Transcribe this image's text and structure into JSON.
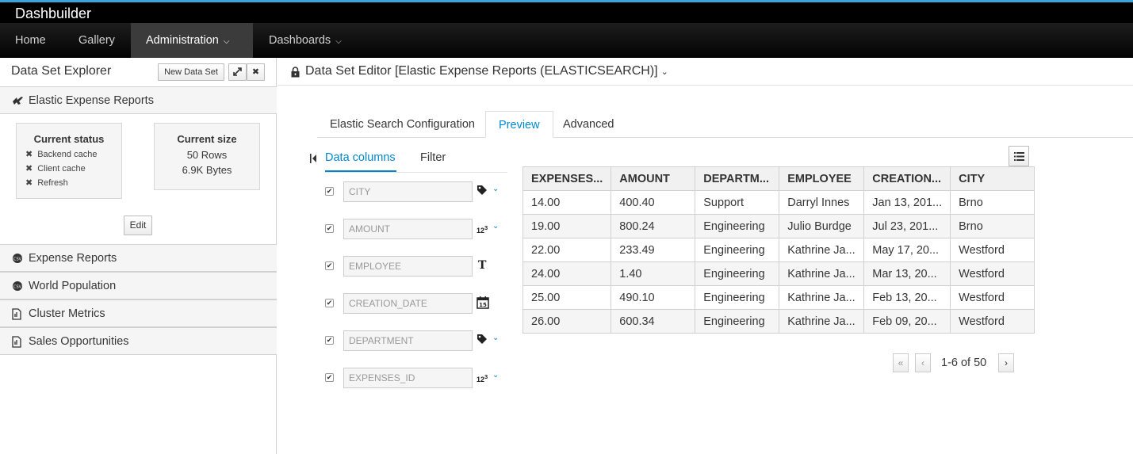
{
  "app": {
    "brand": "Dashbuilder"
  },
  "nav": {
    "items": [
      {
        "label": "Home"
      },
      {
        "label": "Gallery"
      },
      {
        "label": "Administration",
        "active": true,
        "dropdown": true
      },
      {
        "label": "Dashboards",
        "dropdown": true
      }
    ]
  },
  "explorer": {
    "title": "Data Set Explorer",
    "new_button": "New Data Set",
    "expand_icon": "expand-icon",
    "close_icon": "close-icon",
    "datasets": [
      {
        "label": "Elastic Expense Reports",
        "icon": "elastic-icon",
        "expanded": true
      },
      {
        "label": "Expense Reports",
        "icon": "csv-icon"
      },
      {
        "label": "World Population",
        "icon": "csv-icon"
      },
      {
        "label": "Cluster Metrics",
        "icon": "file-icon"
      },
      {
        "label": "Sales Opportunities",
        "icon": "file-icon"
      }
    ],
    "status": {
      "title": "Current status",
      "items": [
        "Backend cache",
        "Client cache",
        "Refresh"
      ]
    },
    "size": {
      "title": "Current size",
      "rows": "50 Rows",
      "bytes": "6.9K Bytes"
    },
    "edit_button": "Edit"
  },
  "editor": {
    "title": "Data Set Editor [Elastic Expense Reports (ELASTICSEARCH)]",
    "tabs": [
      "Elastic Search Configuration",
      "Preview",
      "Advanced"
    ],
    "active_tab": "Preview",
    "subtabs": [
      "Data columns",
      "Filter"
    ],
    "columns": [
      {
        "name": "CITY",
        "type_icon": "label-icon",
        "checked": true
      },
      {
        "name": "AMOUNT",
        "type_icon": "number-icon",
        "checked": true
      },
      {
        "name": "EMPLOYEE",
        "type_icon": "text-icon",
        "checked": true
      },
      {
        "name": "CREATION_DATE",
        "type_icon": "calendar-icon",
        "checked": true
      },
      {
        "name": "DEPARTMENT",
        "type_icon": "label-icon",
        "checked": true
      },
      {
        "name": "EXPENSES_ID",
        "type_icon": "number-icon",
        "checked": true
      }
    ],
    "table": {
      "headers": [
        "EXPENSES...",
        "AMOUNT",
        "DEPARTM...",
        "EMPLOYEE",
        "CREATION...",
        "CITY"
      ],
      "rows": [
        [
          "14.00",
          "400.40",
          "Support",
          "Darryl Innes",
          "Jan 13, 201...",
          "Brno"
        ],
        [
          "19.00",
          "800.24",
          "Engineering",
          "Julio Burdge",
          "Jul 23, 201...",
          "Brno"
        ],
        [
          "22.00",
          "233.49",
          "Engineering",
          "Kathrine Ja...",
          "May 17, 20...",
          "Westford"
        ],
        [
          "24.00",
          "1.40",
          "Engineering",
          "Kathrine Ja...",
          "Mar 13, 20...",
          "Westford"
        ],
        [
          "25.00",
          "490.10",
          "Engineering",
          "Kathrine Ja...",
          "Feb 13, 20...",
          "Westford"
        ],
        [
          "26.00",
          "600.34",
          "Engineering",
          "Kathrine Ja...",
          "Feb 09, 20...",
          "Westford"
        ]
      ]
    },
    "pager": {
      "first": "«",
      "prev": "‹",
      "text": "1-6 of 50",
      "next": "›"
    }
  },
  "colors": {
    "accent": "#0088ce",
    "topbar_line": "#39a5dc",
    "nav_bg": "#030303"
  }
}
